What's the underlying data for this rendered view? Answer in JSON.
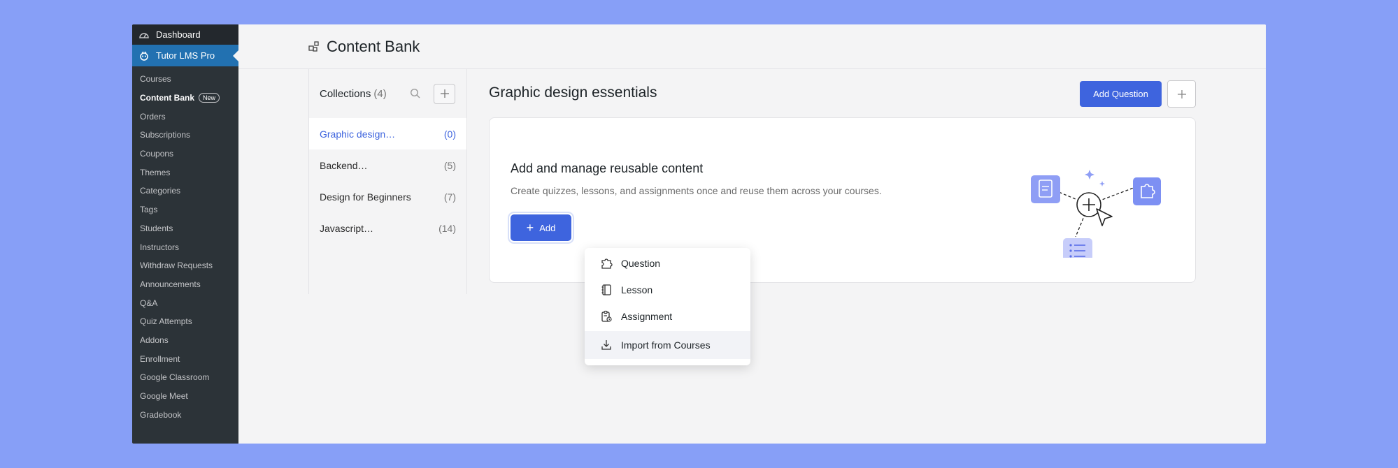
{
  "sidebar": {
    "top_items": [
      {
        "label": "Dashboard",
        "icon": "dashboard-icon"
      },
      {
        "label": "Tutor LMS Pro",
        "icon": "tutor-icon"
      }
    ],
    "submenu": [
      {
        "label": "Courses"
      },
      {
        "label": "Content Bank",
        "badge": "New",
        "current": true
      },
      {
        "label": "Orders"
      },
      {
        "label": "Subscriptions"
      },
      {
        "label": "Coupons"
      },
      {
        "label": "Themes"
      },
      {
        "label": "Categories"
      },
      {
        "label": "Tags"
      },
      {
        "label": "Students"
      },
      {
        "label": "Instructors"
      },
      {
        "label": "Withdraw Requests"
      },
      {
        "label": "Announcements"
      },
      {
        "label": "Q&A"
      },
      {
        "label": "Quiz Attempts"
      },
      {
        "label": "Addons"
      },
      {
        "label": "Enrollment"
      },
      {
        "label": "Google Classroom"
      },
      {
        "label": "Google Meet"
      },
      {
        "label": "Gradebook"
      }
    ]
  },
  "header": {
    "title": "Content Bank",
    "icon": "content-bank-icon"
  },
  "collections": {
    "title": "Collections",
    "count": "(4)",
    "items": [
      {
        "name": "Graphic design…",
        "count": "(0)",
        "active": true
      },
      {
        "name": "Backend…",
        "count": "(5)"
      },
      {
        "name": "Design for Beginners",
        "count": "(7)"
      },
      {
        "name": "Javascript…",
        "count": "(14)"
      }
    ]
  },
  "content": {
    "title": "Graphic design essentials",
    "add_question_label": "Add Question",
    "card": {
      "heading": "Add and manage reusable content",
      "description": "Create quizzes, lessons, and assignments once and reuse them across your courses.",
      "add_label": "Add"
    }
  },
  "dropdown": {
    "items": [
      {
        "label": "Question",
        "icon": "puzzle-icon"
      },
      {
        "label": "Lesson",
        "icon": "notebook-icon"
      },
      {
        "label": "Assignment",
        "icon": "clipboard-icon"
      },
      {
        "label": "Import from Courses",
        "icon": "download-icon",
        "hovered": true
      }
    ]
  },
  "colors": {
    "accent": "#3e64de",
    "wp_sidebar": "#2c3338",
    "wp_active": "#2271b1",
    "background": "#879ff7"
  }
}
